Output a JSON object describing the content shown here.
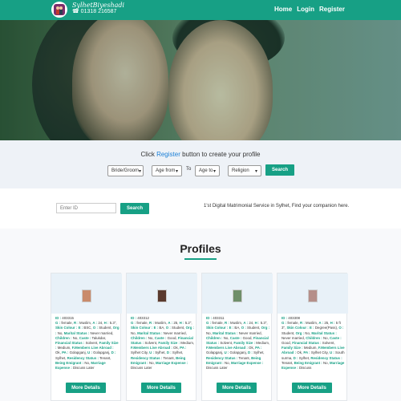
{
  "brand": {
    "name": "SylhetBiyeshadi",
    "phone": "01318 216587",
    "accent": "#17a085"
  },
  "nav": {
    "links": [
      "Home",
      "Login",
      "Register"
    ]
  },
  "hero": {
    "slides": 3,
    "active": 2
  },
  "search": {
    "cta_prefix": "Click ",
    "cta_link": "Register",
    "cta_suffix": " button to create your profile",
    "gender": "Bride/Groom",
    "age_from": "Age from",
    "to": "To",
    "age_to": "Age to",
    "religion": "Religion",
    "button": "Search"
  },
  "id_search": {
    "placeholder": "Enter ID",
    "button": "Search",
    "tagline": "1'st Digital Matrimonial Service in Sylhet, Find your companion here."
  },
  "profiles": {
    "title": "Profiles",
    "more_label": "More Details",
    "cards": [
      {
        "id": "403315",
        "gender": "female",
        "religion": "Muslim",
        "age": "24",
        "height": "5.3\"",
        "skin": "Skin Colour :",
        "e": "E",
        "edu": "BSC",
        "occ": "Student",
        "org": "No",
        "marital": "Never married",
        "children": "No",
        "caste": "Talukdar",
        "fin": "Solvent",
        "family": "Medium",
        "live": "Ok",
        "pa": "Golapganj",
        "pa2": "Golapganj",
        "city": "Sylhet",
        "res": "Residency Status :",
        "res_v": "Tenant",
        "emigrant": "No",
        "marriage_exp": "Discuss Later"
      },
      {
        "id": "403312",
        "gender": "female",
        "religion": "Muslim",
        "age": "25",
        "height": "5.2\"",
        "edu": "BA",
        "occ": "Student",
        "org": "No",
        "marital": "Never married",
        "children": "No",
        "caste": "Good",
        "fin": "Solvent",
        "family": "Medium",
        "live": "Ok",
        "pa": "Sylhet City",
        "pa2": "Sylhet",
        "city": "Sylhet",
        "res_v": "Tenant",
        "emigrant": "No",
        "marriage_exp": "Discuss Later"
      },
      {
        "id": "403311",
        "gender": "female",
        "religion": "Muslim",
        "age": "24",
        "height": "5.3\"",
        "edu": "BA",
        "occ": "Student",
        "org": "No",
        "marital": "Never married",
        "children": "No",
        "caste": "Good",
        "fin": "Solvent",
        "family": "Medium",
        "live": "Ok",
        "pa": "Golapganj",
        "pa2": "Golapganj",
        "city": "Sylhet",
        "res_v": "Tenant",
        "emigrant": "No",
        "marriage_exp": "Discuss Later"
      },
      {
        "id": "403308",
        "gender": "female",
        "religion": "Muslim",
        "age": "25",
        "height": "5 ft 3\"",
        "edu": "Degree(Pass)",
        "occ": "Student",
        "org": "No",
        "marital": "Never married",
        "children": "No",
        "caste": "Good",
        "fin": "Solvent",
        "family": "Medium",
        "live": "Ok",
        "pa": "Sylhet City",
        "pa2": "South surma",
        "city": "Sylhet",
        "res_v": "Tenant",
        "emigrant": "No",
        "marriage_exp": "Discuss"
      }
    ]
  }
}
